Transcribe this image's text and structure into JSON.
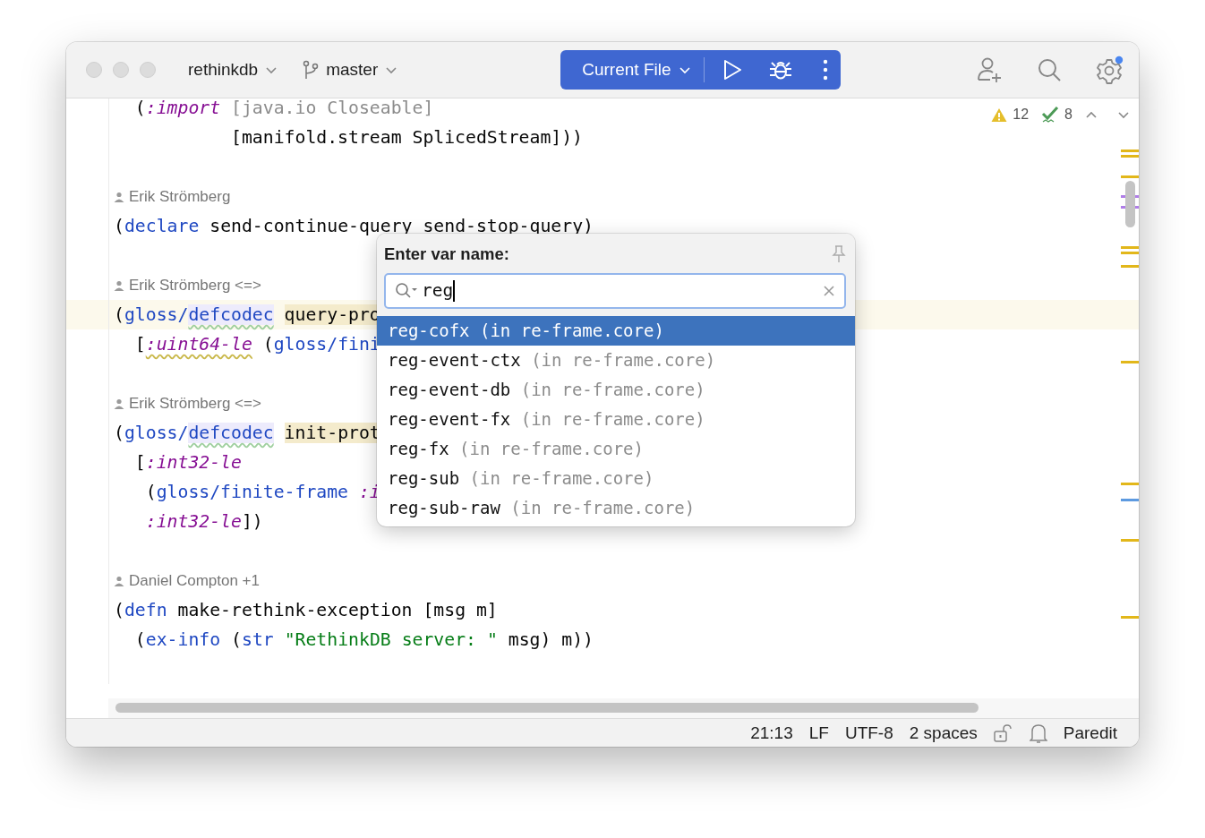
{
  "toolbar": {
    "project": "rethinkdb",
    "branch": "master",
    "run_config": "Current File"
  },
  "inspections": {
    "warnings": "12",
    "checks": "8"
  },
  "editor": {
    "lines": [
      {
        "kind": "code",
        "current": false,
        "tokens": [
          {
            "text": "  (",
            "kind": "plain"
          },
          {
            "text": ":import",
            "kind": "keyword"
          },
          {
            "text": " [java.io Closeable]",
            "kind": "unused"
          }
        ]
      },
      {
        "kind": "code",
        "current": false,
        "tokens": [
          {
            "text": "           [manifold.stream SplicedStream]))",
            "kind": "plain"
          }
        ]
      },
      {
        "kind": "blank"
      },
      {
        "kind": "author",
        "text": "Erik Strömberg"
      },
      {
        "kind": "code",
        "current": false,
        "tokens": [
          {
            "text": "(",
            "kind": "plain"
          },
          {
            "text": "declare",
            "kind": "fn"
          },
          {
            "text": " send-continue-query send-stop-query)",
            "kind": "plain"
          }
        ]
      },
      {
        "kind": "blank"
      },
      {
        "kind": "author",
        "text": "Erik Strömberg <=>"
      },
      {
        "kind": "code",
        "current": true,
        "tokens": [
          {
            "text": "(",
            "kind": "plain"
          },
          {
            "text": "gloss/",
            "kind": "fn"
          },
          {
            "text": "defcodec",
            "kind": "ref"
          },
          {
            "text": " query-pro",
            "kind": "def"
          }
        ]
      },
      {
        "kind": "code",
        "current": false,
        "tokens": [
          {
            "text": "  [",
            "kind": "plain"
          },
          {
            "text": ":uint64-le",
            "kind": "warn"
          },
          {
            "text": " (",
            "kind": "plain"
          },
          {
            "text": "gloss/fini",
            "kind": "fn"
          }
        ]
      },
      {
        "kind": "blank"
      },
      {
        "kind": "author",
        "text": "Erik Strömberg <=>"
      },
      {
        "kind": "code",
        "current": false,
        "tokens": [
          {
            "text": "(",
            "kind": "plain"
          },
          {
            "text": "gloss/",
            "kind": "fn"
          },
          {
            "text": "defcodec",
            "kind": "ref"
          },
          {
            "text": " init-prot",
            "kind": "def"
          }
        ]
      },
      {
        "kind": "code",
        "current": false,
        "tokens": [
          {
            "text": "  [",
            "kind": "plain"
          },
          {
            "text": ":int32-le",
            "kind": "keyword"
          }
        ]
      },
      {
        "kind": "code",
        "current": false,
        "tokens": [
          {
            "text": "   (",
            "kind": "plain"
          },
          {
            "text": "gloss/finite-frame",
            "kind": "fn"
          },
          {
            "text": " :i",
            "kind": "keyword"
          }
        ]
      },
      {
        "kind": "code",
        "current": false,
        "tokens": [
          {
            "text": "   :int32-le",
            "kind": "keyword"
          },
          {
            "text": "])",
            "kind": "plain"
          }
        ]
      },
      {
        "kind": "blank"
      },
      {
        "kind": "author",
        "text": "Daniel Compton +1"
      },
      {
        "kind": "code",
        "current": false,
        "tokens": [
          {
            "text": "(",
            "kind": "plain"
          },
          {
            "text": "defn",
            "kind": "fn"
          },
          {
            "text": " make-rethink-exception [msg m]",
            "kind": "plain"
          }
        ]
      },
      {
        "kind": "code",
        "current": false,
        "tokens": [
          {
            "text": "  (",
            "kind": "plain"
          },
          {
            "text": "ex-info",
            "kind": "fn"
          },
          {
            "text": " (",
            "kind": "plain"
          },
          {
            "text": "str",
            "kind": "fn"
          },
          {
            "text": " \"RethinkDB server: \"",
            "kind": "string"
          },
          {
            "text": " msg) m))",
            "kind": "plain"
          }
        ]
      },
      {
        "kind": "blank"
      }
    ]
  },
  "popup": {
    "title": "Enter var name:",
    "search": {
      "value": "reg"
    },
    "items": [
      {
        "name": "reg-cofx",
        "detail": "(in re-frame.core)",
        "selected": true
      },
      {
        "name": "reg-event-ctx",
        "detail": "(in re-frame.core)",
        "selected": false
      },
      {
        "name": "reg-event-db",
        "detail": "(in re-frame.core)",
        "selected": false
      },
      {
        "name": "reg-event-fx",
        "detail": "(in re-frame.core)",
        "selected": false
      },
      {
        "name": "reg-fx",
        "detail": "(in re-frame.core)",
        "selected": false
      },
      {
        "name": "reg-sub",
        "detail": "(in re-frame.core)",
        "selected": false
      },
      {
        "name": "reg-sub-raw",
        "detail": "(in re-frame.core)",
        "selected": false
      }
    ]
  },
  "status_bar": {
    "position": "21:13",
    "line_separator": "LF",
    "encoding": "UTF-8",
    "indent": "2 spaces",
    "mode": "Paredit"
  }
}
